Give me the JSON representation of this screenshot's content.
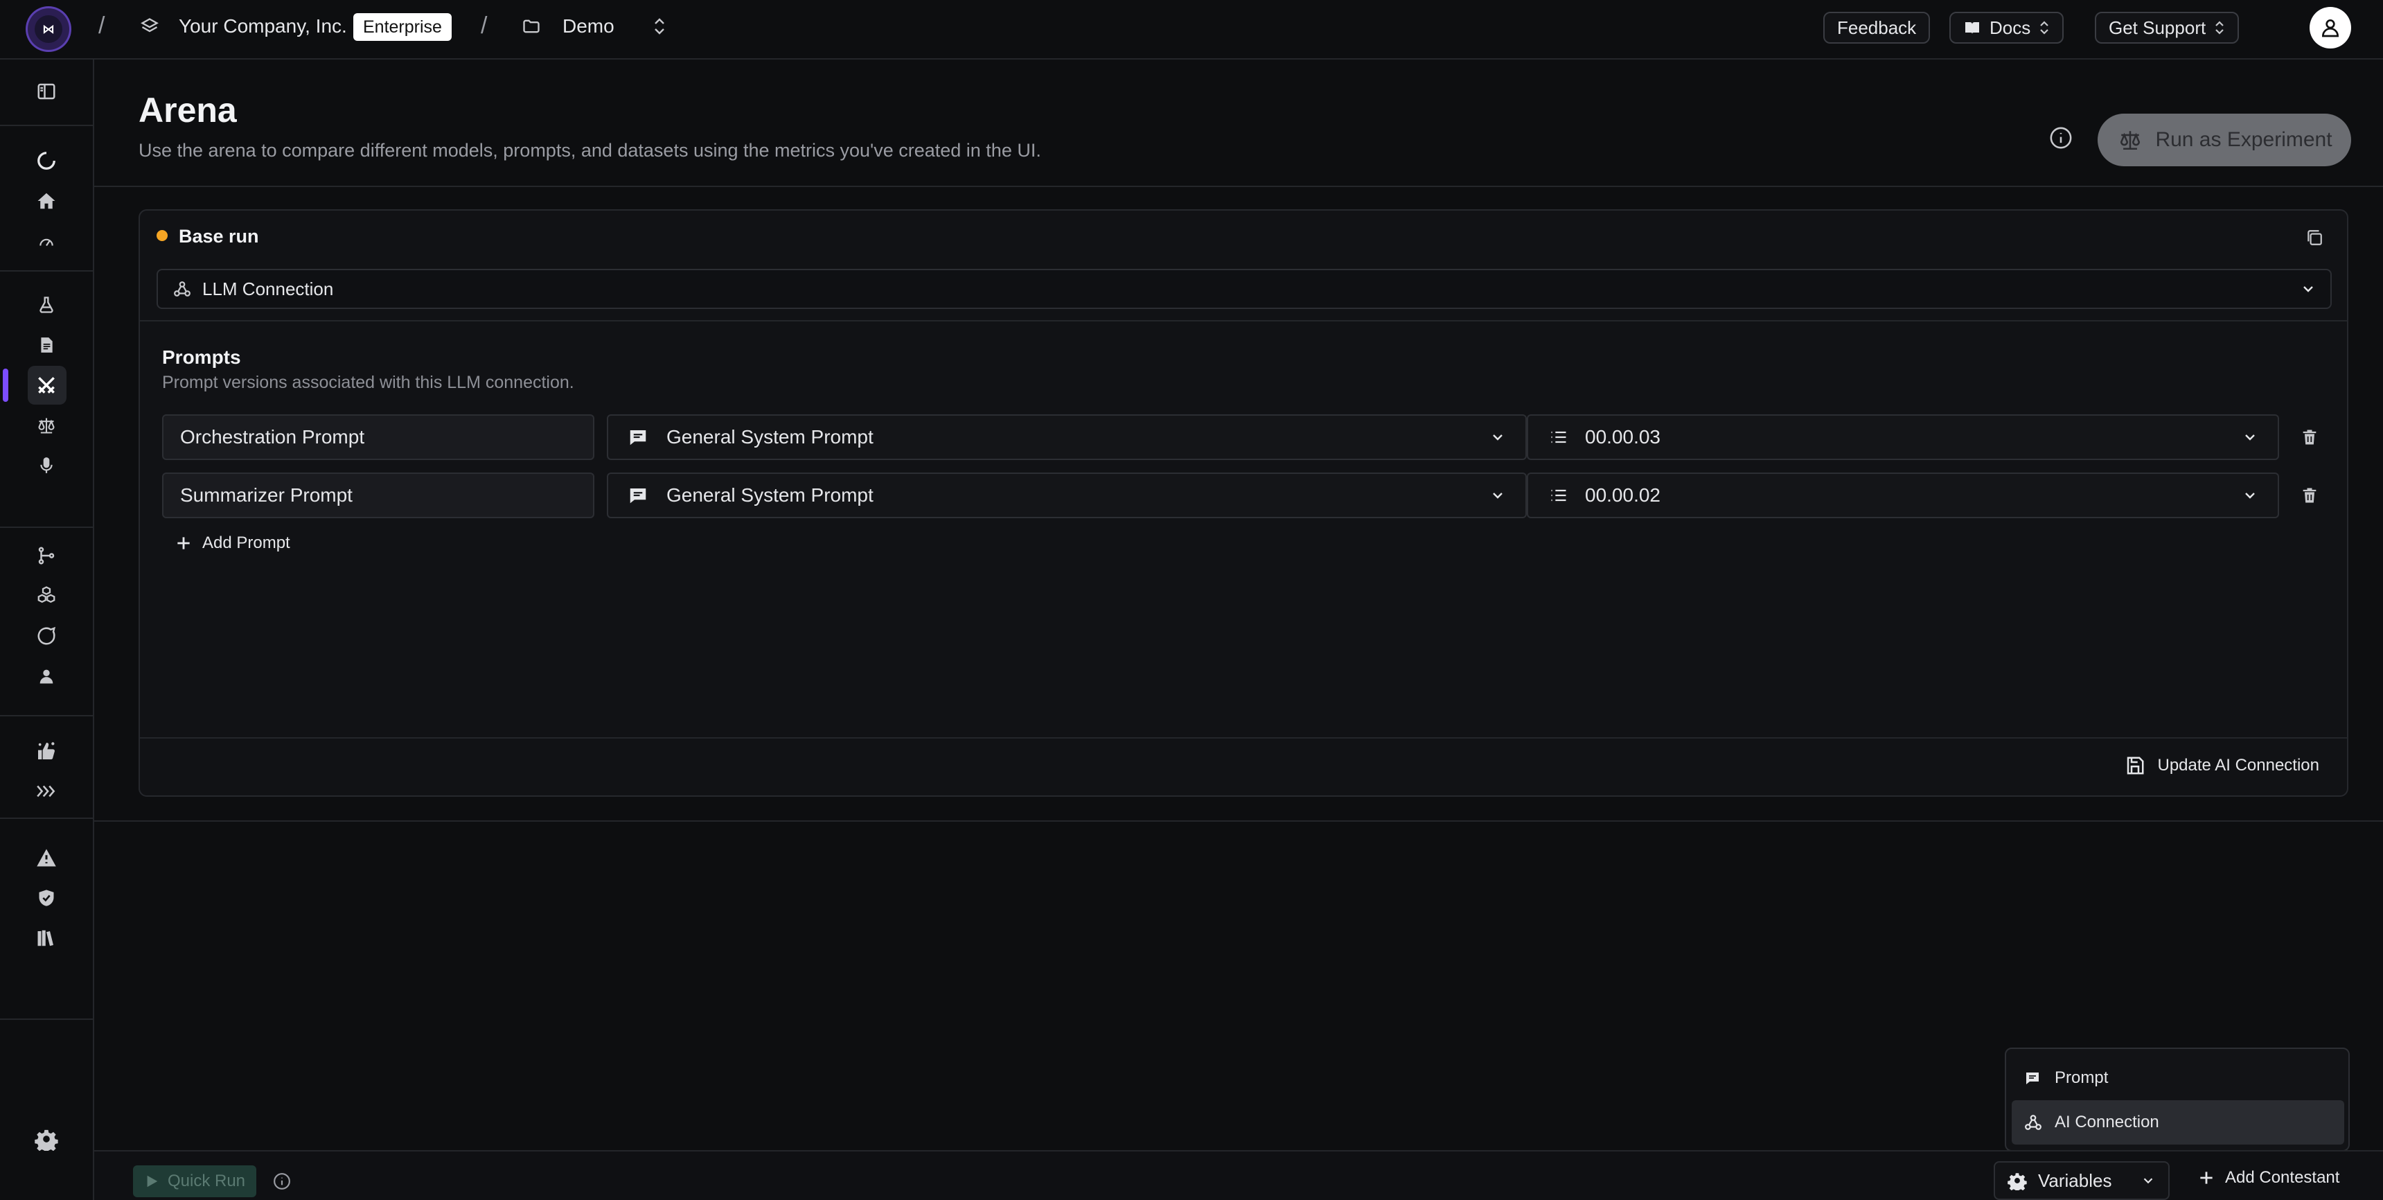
{
  "topbar": {
    "org_name": "Your Company, Inc.",
    "plan_badge": "Enterprise",
    "project_name": "Demo",
    "feedback_label": "Feedback",
    "docs_label": "Docs",
    "support_label": "Get Support",
    "separator": "/"
  },
  "header": {
    "title": "Arena",
    "subtitle": "Use the arena to compare different models, prompts, and datasets using the metrics you've created in the UI.",
    "run_experiment_label": "Run as Experiment"
  },
  "base_run": {
    "label": "Base run",
    "status_color": "#f5a524",
    "connection_select": "LLM Connection",
    "prompts_title": "Prompts",
    "prompts_subtitle": "Prompt versions associated with this LLM connection.",
    "rows": [
      {
        "name": "Orchestration Prompt",
        "prompt": "General System Prompt",
        "version": "00.00.03"
      },
      {
        "name": "Summarizer Prompt",
        "prompt": "General System Prompt",
        "version": "00.00.02"
      }
    ],
    "add_prompt_label": "Add Prompt",
    "update_label": "Update AI Connection"
  },
  "menu": {
    "items": [
      {
        "label": "Prompt",
        "icon": "message-square-icon"
      },
      {
        "label": "AI Connection",
        "icon": "webhook-icon"
      }
    ]
  },
  "bottombar": {
    "quick_run_label": "Quick Run",
    "variables_label": "Variables",
    "add_contestant_label": "Add Contestant"
  },
  "colors": {
    "accent": "#7c4dff",
    "base_run_dot": "#f5a524",
    "quick_run_bg": "#1f3b35"
  }
}
